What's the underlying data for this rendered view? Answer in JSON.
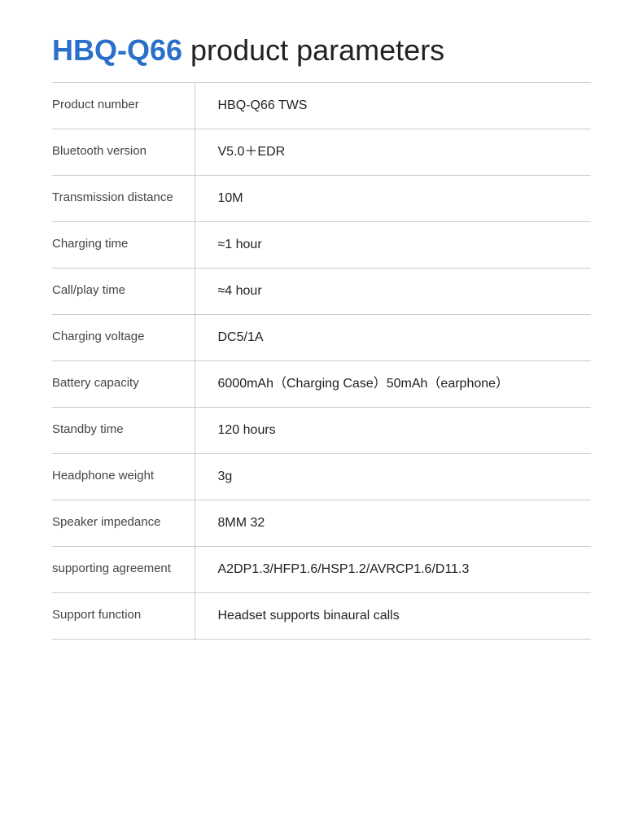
{
  "page": {
    "title_brand": "HBQ-Q66",
    "title_rest": " product parameters"
  },
  "rows": [
    {
      "label": "Product number",
      "value": "HBQ-Q66 TWS"
    },
    {
      "label": "Bluetooth version",
      "value": "V5.0＋EDR"
    },
    {
      "label": "Transmission distance",
      "value": "10M"
    },
    {
      "label": "Charging time",
      "value": "≈1 hour"
    },
    {
      "label": "Call/play time",
      "value": "≈4 hour"
    },
    {
      "label": "Charging voltage",
      "value": "DC5/1A"
    },
    {
      "label": "Battery capacity",
      "value": "6000mAh（Charging Case）50mAh（earphone）"
    },
    {
      "label": "Standby time",
      "value": "120 hours"
    },
    {
      "label": "Headphone weight",
      "value": "3g"
    },
    {
      "label": "Speaker impedance",
      "value": "8MM 32"
    },
    {
      "label": "supporting agreement",
      "value": "A2DP1.3/HFP1.6/HSP1.2/AVRCP1.6/D11.3"
    },
    {
      "label": "Support function",
      "value": "Headset supports binaural calls"
    }
  ]
}
